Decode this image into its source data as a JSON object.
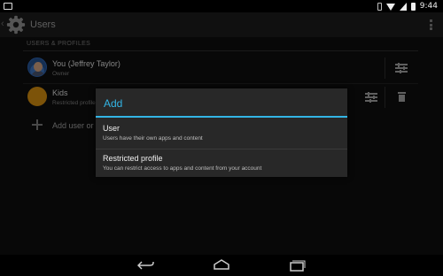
{
  "status_bar": {
    "time": "9:44",
    "icons": [
      "screenshot-icon",
      "phone-icon",
      "wifi-icon",
      "signal-icon",
      "battery-icon"
    ]
  },
  "action_bar": {
    "title": "Users",
    "icon": "settings-gear-icon",
    "overflow_icon": "overflow-menu-icon"
  },
  "section": {
    "header": "USERS & PROFILES"
  },
  "users": [
    {
      "name": "You (Jeffrey Taylor)",
      "subtitle": "Owner",
      "avatar": "user-photo-avatar",
      "actions": [
        "settings-sliders-icon"
      ]
    },
    {
      "name": "Kids",
      "subtitle": "Restricted profile",
      "avatar": "orange-avatar",
      "actions": [
        "settings-sliders-icon",
        "trash-icon"
      ]
    }
  ],
  "add_row": {
    "label": "Add user or profile",
    "icon": "plus-icon"
  },
  "dialog": {
    "title": "Add",
    "options": [
      {
        "title": "User",
        "subtitle": "Users have their own apps and content"
      },
      {
        "title": "Restricted profile",
        "subtitle": "You can restrict access to apps and content from your account"
      }
    ]
  },
  "nav_bar": {
    "icons": [
      "back-icon",
      "home-icon",
      "recents-icon"
    ]
  },
  "colors": {
    "accent": "#33b5e5",
    "dialog_bg": "#282828",
    "content_bg": "#0e0e0e",
    "kids_avatar": "#c8860f"
  }
}
